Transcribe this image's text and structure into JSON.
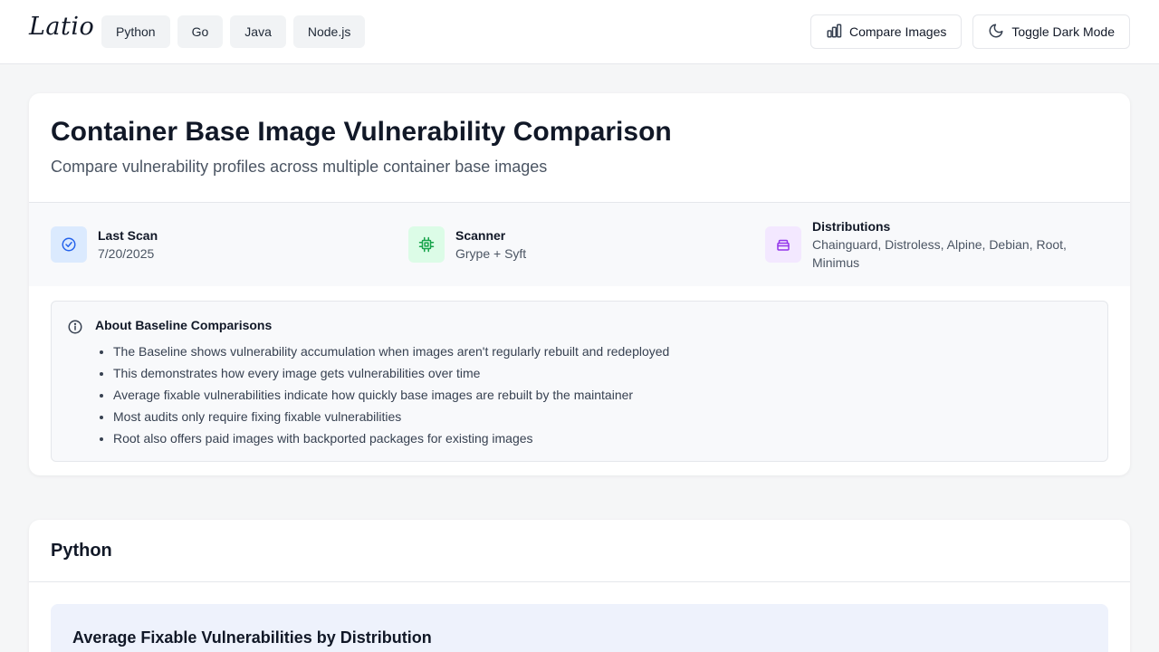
{
  "header": {
    "logo": "Latio",
    "languages": [
      "Python",
      "Go",
      "Java",
      "Node.js"
    ],
    "compare_label": "Compare Images",
    "dark_mode_label": "Toggle Dark Mode"
  },
  "overview": {
    "title": "Container Base Image Vulnerability Comparison",
    "subtitle": "Compare vulnerability profiles across multiple container base images",
    "meta": {
      "last_scan_label": "Last Scan",
      "last_scan_value": "7/20/2025",
      "scanner_label": "Scanner",
      "scanner_value": "Grype + Syft",
      "distributions_label": "Distributions",
      "distributions_value": "Chainguard, Distroless, Alpine, Debian, Root, Minimus"
    },
    "about": {
      "title": "About Baseline Comparisons",
      "items": [
        "The Baseline shows vulnerability accumulation when images aren't regularly rebuilt and redeployed",
        "This demonstrates how every image gets vulnerabilities over time",
        "Average fixable vulnerabilities indicate how quickly base images are rebuilt by the maintainer",
        "Most audits only require fixing fixable vulnerabilities",
        "Root also offers paid images with backported packages for existing images"
      ]
    }
  },
  "python_section": {
    "title": "Python",
    "chart_title": "Average Fixable Vulnerabilities by Distribution"
  },
  "colors": {
    "scan_icon_bg": "#dbeafe",
    "scan_icon": "#2563eb",
    "scanner_icon_bg": "#dcfce7",
    "scanner_icon": "#16a34a",
    "dist_icon_bg": "#f3e8ff",
    "dist_icon": "#9333ea"
  }
}
